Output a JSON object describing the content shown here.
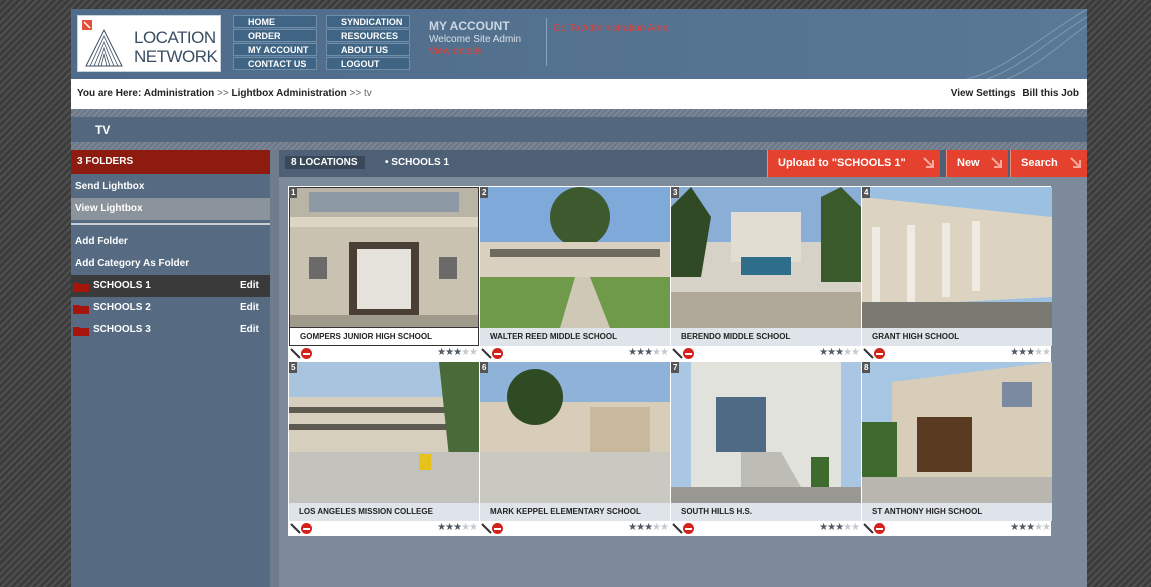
{
  "logo": {
    "line1": "LOCATION",
    "line2": "NETWORK"
  },
  "nav": {
    "col1": [
      "HOME",
      "ORDER",
      "MY ACCOUNT",
      "CONTACT US"
    ],
    "col2": [
      "SYNDICATION",
      "RESOURCES",
      "ABOUT US",
      "LOGOUT"
    ]
  },
  "account": {
    "title": "MY ACCOUNT",
    "welcome": "Welcome Site Admin",
    "view_details": "View details"
  },
  "admin_link": "Go To Administration Area",
  "breadcrumb": {
    "prefix": "You are Here:",
    "a1": "Administration",
    "sep": ">>",
    "a2": "Lightbox Administration",
    "current": "tv"
  },
  "breadcrumb_actions": {
    "view_settings": "View Settings",
    "bill": "Bill this Job"
  },
  "page_title": "TV",
  "sidebar": {
    "folders_header": "3 FOLDERS",
    "send": "Send Lightbox",
    "view": "View Lightbox",
    "add_folder": "Add Folder",
    "add_category": "Add Category As Folder",
    "edit_label": "Edit",
    "folders": [
      "SCHOOLS 1",
      "SCHOOLS 2",
      "SCHOOLS 3"
    ]
  },
  "main": {
    "count": "8 LOCATIONS",
    "crumb": "• SCHOOLS 1",
    "upload": "Upload to \"SCHOOLS 1\"",
    "new": "New",
    "search": "Search"
  },
  "locations": [
    {
      "num": "1",
      "name": "GOMPERS JUNIOR HIGH SCHOOL",
      "rating": 3
    },
    {
      "num": "2",
      "name": "WALTER REED MIDDLE SCHOOL",
      "rating": 3
    },
    {
      "num": "3",
      "name": "BERENDO MIDDLE SCHOOL",
      "rating": 3
    },
    {
      "num": "4",
      "name": "GRANT HIGH SCHOOL",
      "rating": 3
    },
    {
      "num": "5",
      "name": "LOS ANGELES MISSION COLLEGE",
      "rating": 3
    },
    {
      "num": "6",
      "name": "MARK KEPPEL ELEMENTARY SCHOOL",
      "rating": 3
    },
    {
      "num": "7",
      "name": "SOUTH HILLS H.S.",
      "rating": 3
    },
    {
      "num": "8",
      "name": "ST ANTHONY HIGH SCHOOL",
      "rating": 3
    }
  ],
  "colors": {
    "accent_red": "#e4412e",
    "header_blue": "#4f6c8a",
    "folder_red": "#8e1b10"
  }
}
